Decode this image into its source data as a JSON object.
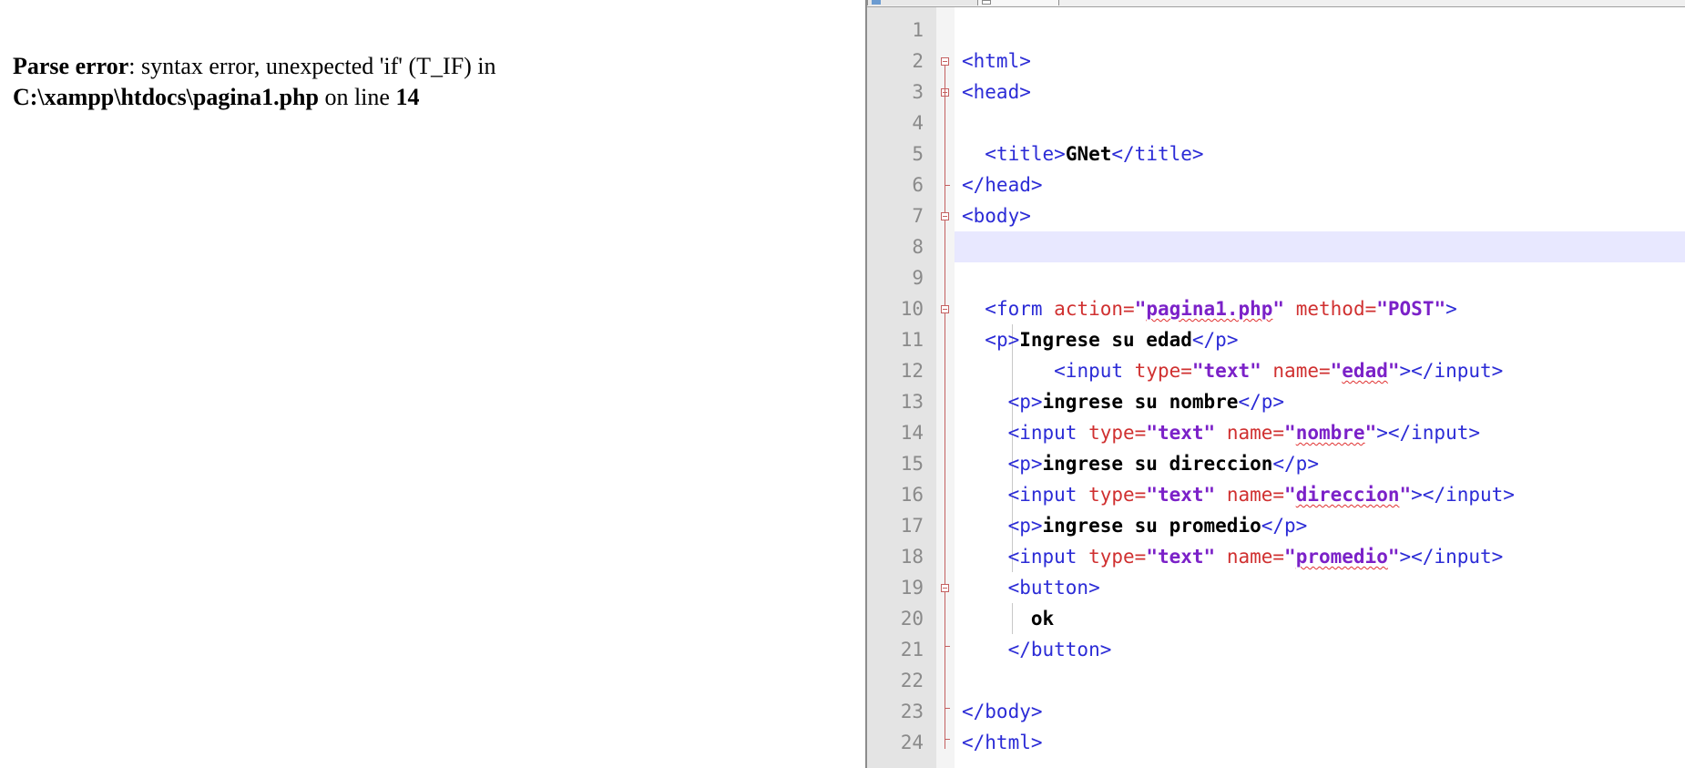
{
  "browser": {
    "error": {
      "label": "Parse error",
      "message": ": syntax error, unexpected 'if' (T_IF) in ",
      "file": "C:\\xampp\\htdocs\\pagina1.php",
      "on_line_text": " on line ",
      "line": "14"
    }
  },
  "editor": {
    "current_line": 8,
    "line_numbers": [
      "1",
      "2",
      "3",
      "4",
      "5",
      "6",
      "7",
      "8",
      "9",
      "10",
      "11",
      "12",
      "13",
      "14",
      "15",
      "16",
      "17",
      "18",
      "19",
      "20",
      "21",
      "22",
      "23",
      "24"
    ],
    "code": {
      "l2_html": "<html>",
      "l3_head": "<head>",
      "l5_title_open": "<title>",
      "l5_title_text": "GNet",
      "l5_title_close": "</title>",
      "l6_head_close": "</head>",
      "l7_body": "<body>",
      "l10_form_open": "<form",
      "l10_action_attr": "action=",
      "l10_q1": "\"",
      "l10_action_val": "pagina1.php",
      "l10_q2": "\"",
      "l10_method_attr": "method=",
      "l10_method_val": "\"POST\"",
      "l10_close": ">",
      "l11_p_open": "<p>",
      "l11_text": "Ingrese su edad",
      "l11_p_close": "</p>",
      "l12_input": "<input",
      "l12_type_attr": "type=",
      "l12_type_val": "\"text\"",
      "l12_name_attr": "name=",
      "l12_q1": "\"",
      "l12_name_val": "edad",
      "l12_q2": "\"",
      "l12_close": "></input>",
      "l13_p_open": "<p>",
      "l13_text": "ingrese su nombre",
      "l13_p_close": "</p>",
      "l14_input": "<input",
      "l14_type_attr": "type=",
      "l14_type_val": "\"text\"",
      "l14_name_attr": "name=",
      "l14_q1": "\"",
      "l14_name_val": "nombre",
      "l14_q2": "\"",
      "l14_close": "></input>",
      "l15_p_open": "<p>",
      "l15_text": "ingrese su direccion",
      "l15_p_close": "</p>",
      "l16_input": "<input",
      "l16_type_attr": "type=",
      "l16_type_val": "\"text\"",
      "l16_name_attr": "name=",
      "l16_q1": "\"",
      "l16_name_val": "direccion",
      "l16_q2": "\"",
      "l16_close": "></input>",
      "l17_p_open": "<p>",
      "l17_text": "ingrese su promedio",
      "l17_p_close": "</p>",
      "l18_input": "<input",
      "l18_type_attr": "type=",
      "l18_type_val": "\"text\"",
      "l18_name_attr": "name=",
      "l18_q1": "\"",
      "l18_name_val": "promedio",
      "l18_q2": "\"",
      "l18_close": "></input>",
      "l19_button": "<button>",
      "l20_text": "ok",
      "l21_button_close": "</button>",
      "l23_body_close": "</body>",
      "l24_html_close": "</html>"
    }
  }
}
